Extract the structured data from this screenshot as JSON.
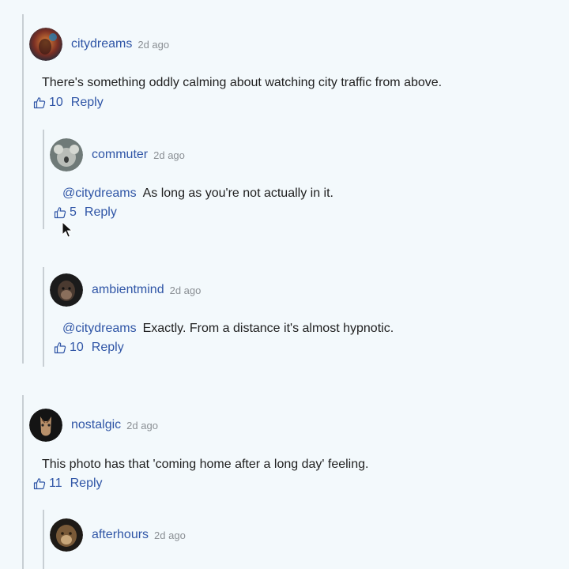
{
  "comments": [
    {
      "user": "citydreams",
      "time": "2d ago",
      "mention": "",
      "text": "There's something oddly calming about watching city traffic from above.",
      "likes": "10",
      "reply_label": "Reply",
      "replies": [
        {
          "user": "commuter",
          "time": "2d ago",
          "mention": "@citydreams",
          "text": "As long as you're not actually in it.",
          "likes": "5",
          "reply_label": "Reply"
        },
        {
          "user": "ambientmind",
          "time": "2d ago",
          "mention": "@citydreams",
          "text": "Exactly. From a distance it's almost hypnotic.",
          "likes": "10",
          "reply_label": "Reply"
        }
      ]
    },
    {
      "user": "nostalgic",
      "time": "2d ago",
      "mention": "",
      "text": "This photo has that 'coming home after a long day' feeling.",
      "likes": "11",
      "reply_label": "Reply",
      "replies": [
        {
          "user": "afterhours",
          "time": "2d ago"
        }
      ]
    }
  ],
  "colors": {
    "background": "#f3f9fc",
    "link": "#2f55a6",
    "muted": "#8a8f94",
    "thread_line": "#c8cfd4"
  },
  "icons": {
    "like": "thumbs-up-icon",
    "cursor": "mouse-pointer-icon"
  }
}
